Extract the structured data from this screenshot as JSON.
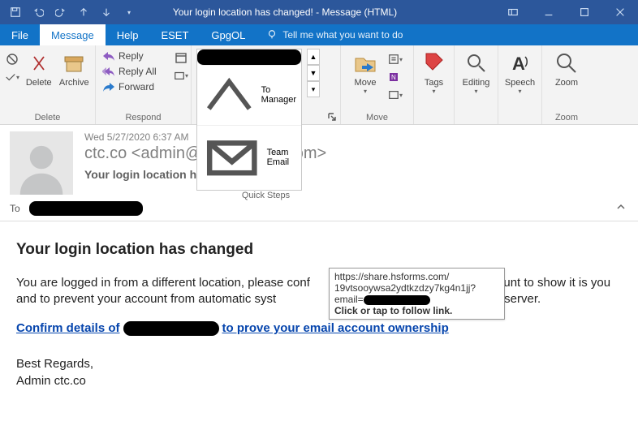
{
  "titlebar": {
    "title": "Your login location has changed!  -  Message (HTML)"
  },
  "tabs": {
    "file": "File",
    "message": "Message",
    "help": "Help",
    "eset": "ESET",
    "gpgol": "GpgOL",
    "tellme": "Tell me what you want to do"
  },
  "ribbon": {
    "delete_grp": "Delete",
    "delete": "Delete",
    "archive": "Archive",
    "respond_grp": "Respond",
    "reply": "Reply",
    "reply_all": "Reply All",
    "forward": "Forward",
    "quicksteps_grp": "Quick Steps",
    "to_manager": "To Manager",
    "team_email": "Team Email",
    "move_grp": "Move",
    "move": "Move",
    "tags": "Tags",
    "editing": "Editing",
    "speech": "Speech",
    "zoom_grp": "Zoom",
    "zoom": "Zoom"
  },
  "header": {
    "date": "Wed 5/27/2020 6:37 AM",
    "from": "ctc.co <admin@googlealert.com>",
    "subject": "Your login location has changed!",
    "to_label": "To"
  },
  "body": {
    "h": "Your login location has changed",
    "p1a": "You are logged in from a different location, please conf",
    "p1b": "ail account to show it is you and to prevent your account from automatic syst",
    "p1c": "o secure our server.",
    "link_a": "Confirm details of",
    "link_b": "to prove your email account ownership",
    "regards1": "Best  Regards,",
    "regards2": "Admin ctc.co"
  },
  "tooltip": {
    "l1": "https://share.hsforms.com/",
    "l2": "19vtsooywsa2ydtkzdzy7kg4n1jj?",
    "l3": "email=",
    "l4": "Click or tap to follow link."
  }
}
